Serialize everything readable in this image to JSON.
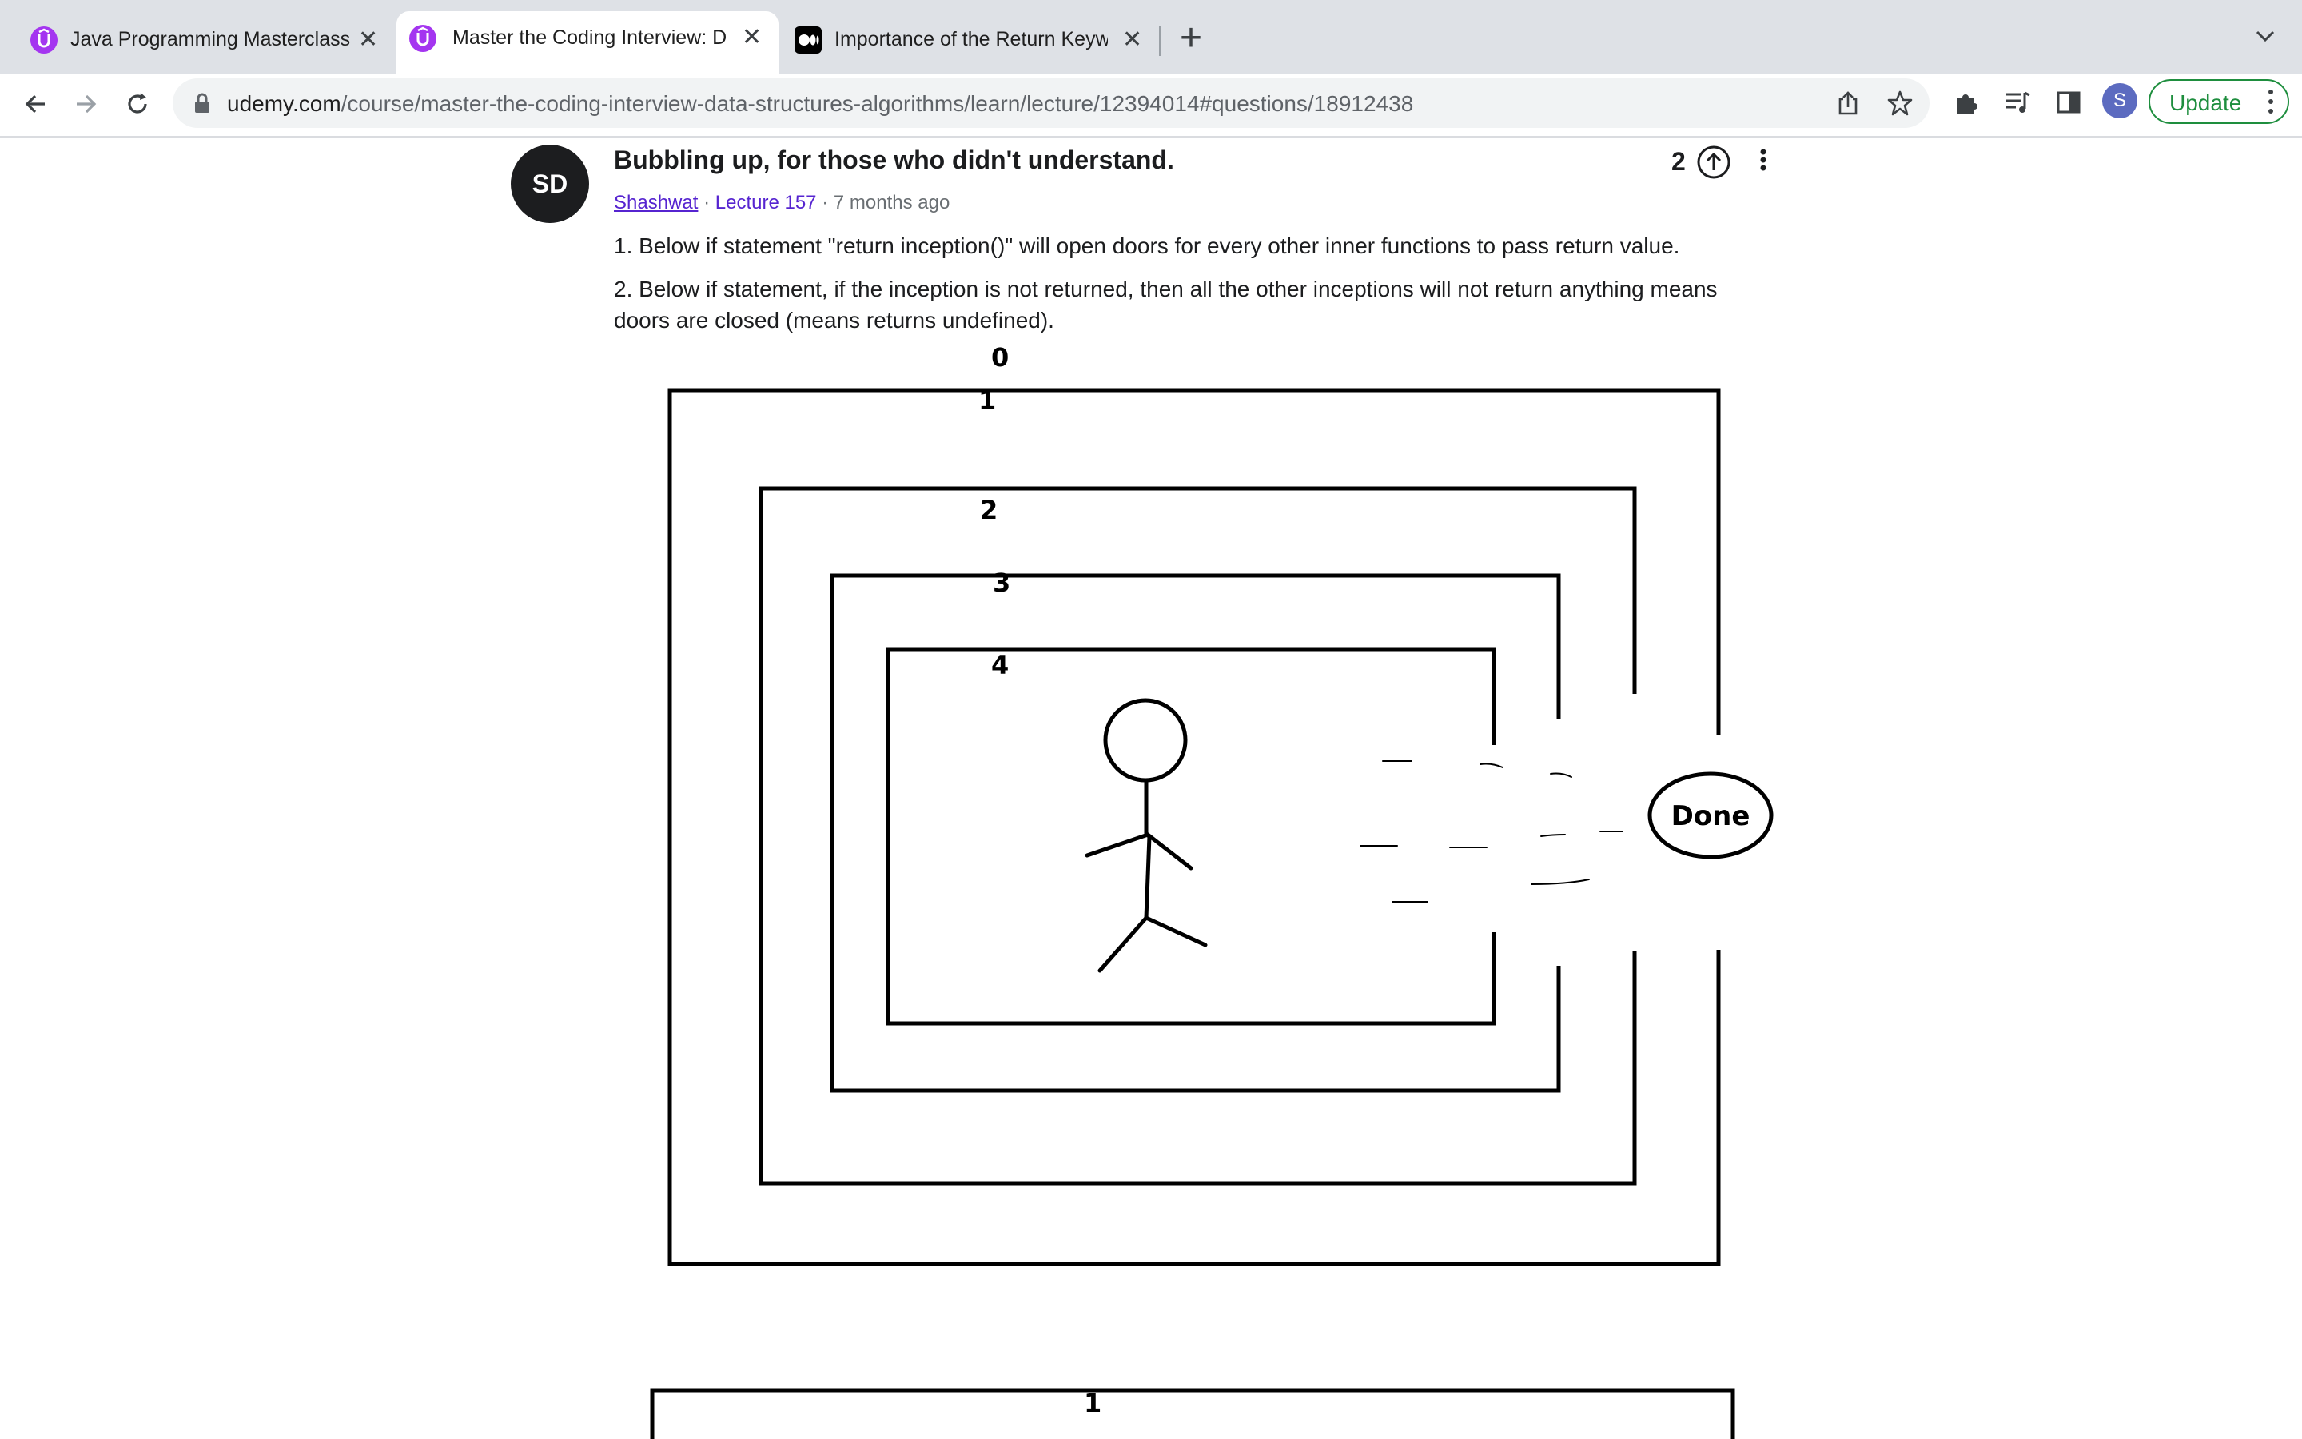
{
  "browser": {
    "tabs": [
      {
        "title": "Java Programming Masterclass",
        "favicon": "udemy-icon",
        "active": false
      },
      {
        "title": "Master the Coding Interview: D",
        "favicon": "udemy-icon",
        "active": true
      },
      {
        "title": "Importance of the Return Keyw",
        "favicon": "medium-icon",
        "active": false
      }
    ],
    "new_tab": "+",
    "url_host": "udemy.com",
    "url_path": "/course/master-the-coding-interview-data-structures-algorithms/learn/lecture/12394014#questions/18912438",
    "profile_initial": "S",
    "update_label": "Update"
  },
  "question": {
    "avatar_initials": "SD",
    "title": "Bubbling up, for those who didn't understand.",
    "author": "Shashwat",
    "lecture": "Lecture 157",
    "age": "7 months ago",
    "votes": "2",
    "body": [
      "1.  Below if statement \"return inception()\" will open doors for every other inner functions to pass return value.",
      "2. Below if statement, if the inception is not returned, then all the other inceptions will not return anything means doors are closed (means returns undefined)."
    ]
  },
  "drawing": {
    "levels": [
      "0",
      "1",
      "2",
      "3",
      "4"
    ],
    "exit_label": "Done",
    "second_drawing_level": "1"
  },
  "colors": {
    "udemy_purple": "#a435f0",
    "link": "#5624d0",
    "update_green": "#1e8e3e",
    "avatar_profile": "#5c6bc0"
  }
}
